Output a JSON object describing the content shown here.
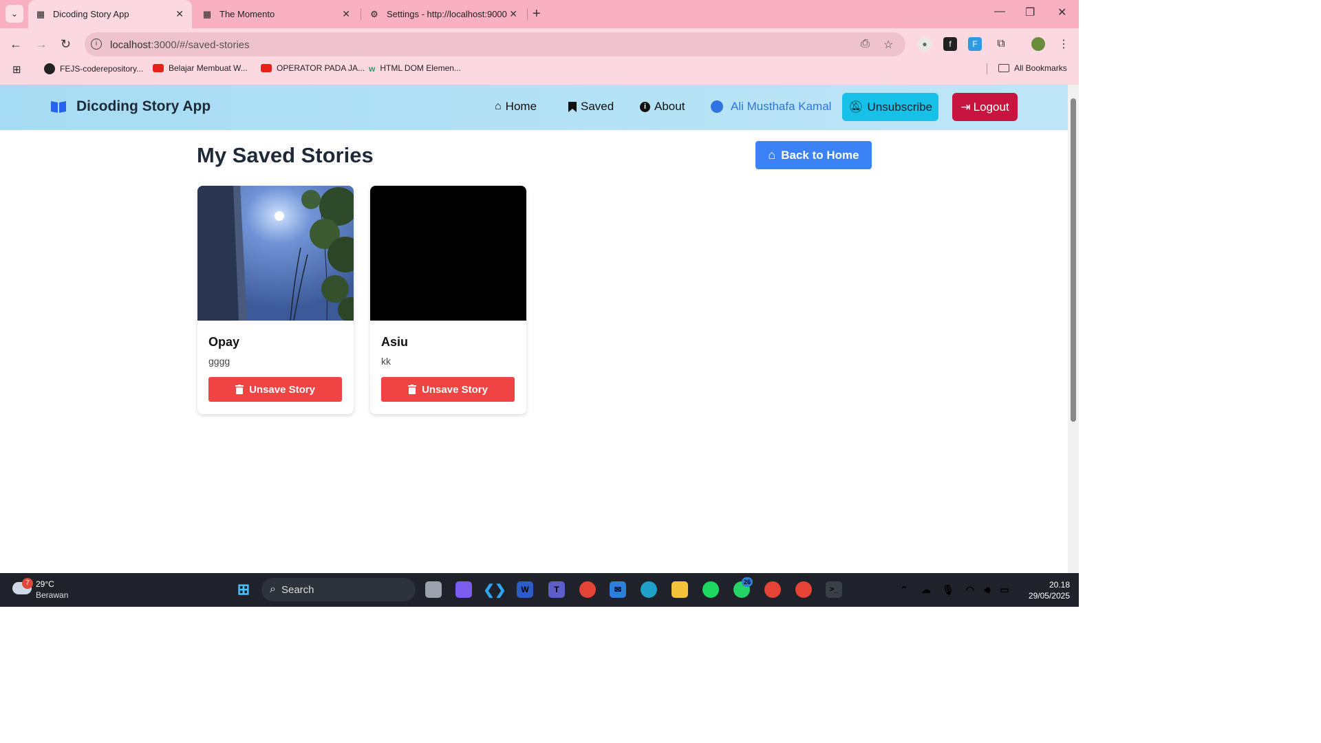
{
  "browser": {
    "tabs": [
      {
        "title": "Dicoding Story App"
      },
      {
        "title": "The Momento"
      },
      {
        "title": "Settings - http://localhost:9000"
      }
    ],
    "url_host": "localhost",
    "url_path": ":3000/#/saved-stories",
    "bookmarks": [
      {
        "label": "FEJS-coderepository..."
      },
      {
        "label": "Belajar Membuat W..."
      },
      {
        "label": "OPERATOR PADA JA..."
      },
      {
        "label": "HTML DOM Elemen..."
      }
    ],
    "all_bookmarks": "All Bookmarks"
  },
  "app": {
    "brand": "Dicoding Story App",
    "nav": {
      "home": "Home",
      "saved": "Saved",
      "about": "About",
      "user": "Ali Musthafa Kamal",
      "unsubscribe": "Unsubscribe",
      "logout": "Logout"
    },
    "page_title": "My Saved Stories",
    "back_home": "Back to Home",
    "stories": [
      {
        "title": "Opay",
        "description": "gggg",
        "button": "Unsave Story"
      },
      {
        "title": "Asiu",
        "description": "kk",
        "button": "Unsave Story"
      }
    ]
  },
  "taskbar": {
    "weather_temp": "29°C",
    "weather_desc": "Berawan",
    "weather_badge": "7",
    "search": "Search",
    "whatsapp_badge": "26",
    "time": "20.18",
    "date": "29/05/2025"
  }
}
